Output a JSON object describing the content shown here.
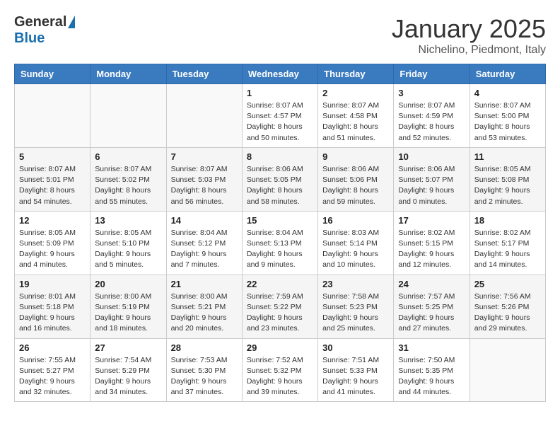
{
  "header": {
    "logo_general": "General",
    "logo_blue": "Blue",
    "month_title": "January 2025",
    "subtitle": "Nichelino, Piedmont, Italy"
  },
  "weekdays": [
    "Sunday",
    "Monday",
    "Tuesday",
    "Wednesday",
    "Thursday",
    "Friday",
    "Saturday"
  ],
  "weeks": [
    [
      {
        "day": "",
        "info": "",
        "empty": true
      },
      {
        "day": "",
        "info": "",
        "empty": true
      },
      {
        "day": "",
        "info": "",
        "empty": true
      },
      {
        "day": "1",
        "info": "Sunrise: 8:07 AM\nSunset: 4:57 PM\nDaylight: 8 hours\nand 50 minutes."
      },
      {
        "day": "2",
        "info": "Sunrise: 8:07 AM\nSunset: 4:58 PM\nDaylight: 8 hours\nand 51 minutes."
      },
      {
        "day": "3",
        "info": "Sunrise: 8:07 AM\nSunset: 4:59 PM\nDaylight: 8 hours\nand 52 minutes."
      },
      {
        "day": "4",
        "info": "Sunrise: 8:07 AM\nSunset: 5:00 PM\nDaylight: 8 hours\nand 53 minutes."
      }
    ],
    [
      {
        "day": "5",
        "info": "Sunrise: 8:07 AM\nSunset: 5:01 PM\nDaylight: 8 hours\nand 54 minutes."
      },
      {
        "day": "6",
        "info": "Sunrise: 8:07 AM\nSunset: 5:02 PM\nDaylight: 8 hours\nand 55 minutes."
      },
      {
        "day": "7",
        "info": "Sunrise: 8:07 AM\nSunset: 5:03 PM\nDaylight: 8 hours\nand 56 minutes."
      },
      {
        "day": "8",
        "info": "Sunrise: 8:06 AM\nSunset: 5:05 PM\nDaylight: 8 hours\nand 58 minutes."
      },
      {
        "day": "9",
        "info": "Sunrise: 8:06 AM\nSunset: 5:06 PM\nDaylight: 8 hours\nand 59 minutes."
      },
      {
        "day": "10",
        "info": "Sunrise: 8:06 AM\nSunset: 5:07 PM\nDaylight: 9 hours\nand 0 minutes."
      },
      {
        "day": "11",
        "info": "Sunrise: 8:05 AM\nSunset: 5:08 PM\nDaylight: 9 hours\nand 2 minutes."
      }
    ],
    [
      {
        "day": "12",
        "info": "Sunrise: 8:05 AM\nSunset: 5:09 PM\nDaylight: 9 hours\nand 4 minutes."
      },
      {
        "day": "13",
        "info": "Sunrise: 8:05 AM\nSunset: 5:10 PM\nDaylight: 9 hours\nand 5 minutes."
      },
      {
        "day": "14",
        "info": "Sunrise: 8:04 AM\nSunset: 5:12 PM\nDaylight: 9 hours\nand 7 minutes."
      },
      {
        "day": "15",
        "info": "Sunrise: 8:04 AM\nSunset: 5:13 PM\nDaylight: 9 hours\nand 9 minutes."
      },
      {
        "day": "16",
        "info": "Sunrise: 8:03 AM\nSunset: 5:14 PM\nDaylight: 9 hours\nand 10 minutes."
      },
      {
        "day": "17",
        "info": "Sunrise: 8:02 AM\nSunset: 5:15 PM\nDaylight: 9 hours\nand 12 minutes."
      },
      {
        "day": "18",
        "info": "Sunrise: 8:02 AM\nSunset: 5:17 PM\nDaylight: 9 hours\nand 14 minutes."
      }
    ],
    [
      {
        "day": "19",
        "info": "Sunrise: 8:01 AM\nSunset: 5:18 PM\nDaylight: 9 hours\nand 16 minutes."
      },
      {
        "day": "20",
        "info": "Sunrise: 8:00 AM\nSunset: 5:19 PM\nDaylight: 9 hours\nand 18 minutes."
      },
      {
        "day": "21",
        "info": "Sunrise: 8:00 AM\nSunset: 5:21 PM\nDaylight: 9 hours\nand 20 minutes."
      },
      {
        "day": "22",
        "info": "Sunrise: 7:59 AM\nSunset: 5:22 PM\nDaylight: 9 hours\nand 23 minutes."
      },
      {
        "day": "23",
        "info": "Sunrise: 7:58 AM\nSunset: 5:23 PM\nDaylight: 9 hours\nand 25 minutes."
      },
      {
        "day": "24",
        "info": "Sunrise: 7:57 AM\nSunset: 5:25 PM\nDaylight: 9 hours\nand 27 minutes."
      },
      {
        "day": "25",
        "info": "Sunrise: 7:56 AM\nSunset: 5:26 PM\nDaylight: 9 hours\nand 29 minutes."
      }
    ],
    [
      {
        "day": "26",
        "info": "Sunrise: 7:55 AM\nSunset: 5:27 PM\nDaylight: 9 hours\nand 32 minutes."
      },
      {
        "day": "27",
        "info": "Sunrise: 7:54 AM\nSunset: 5:29 PM\nDaylight: 9 hours\nand 34 minutes."
      },
      {
        "day": "28",
        "info": "Sunrise: 7:53 AM\nSunset: 5:30 PM\nDaylight: 9 hours\nand 37 minutes."
      },
      {
        "day": "29",
        "info": "Sunrise: 7:52 AM\nSunset: 5:32 PM\nDaylight: 9 hours\nand 39 minutes."
      },
      {
        "day": "30",
        "info": "Sunrise: 7:51 AM\nSunset: 5:33 PM\nDaylight: 9 hours\nand 41 minutes."
      },
      {
        "day": "31",
        "info": "Sunrise: 7:50 AM\nSunset: 5:35 PM\nDaylight: 9 hours\nand 44 minutes."
      },
      {
        "day": "",
        "info": "",
        "empty": true
      }
    ]
  ]
}
